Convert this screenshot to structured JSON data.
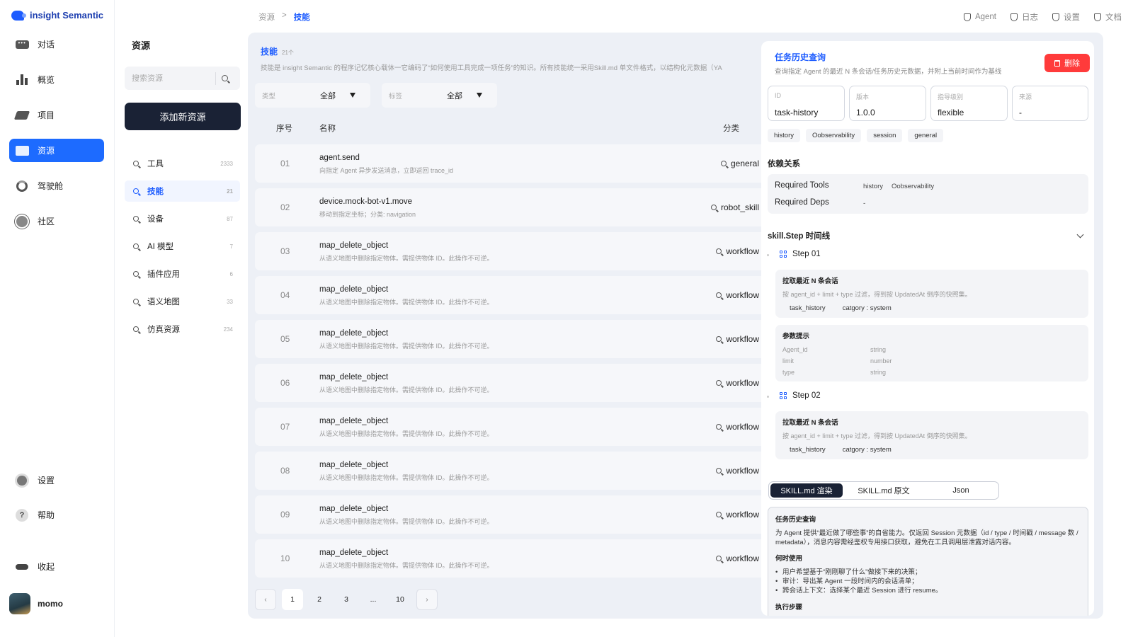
{
  "app": {
    "title": "insight Semantic"
  },
  "nav": {
    "items": [
      {
        "label": "对话",
        "icon": "chat-icon"
      },
      {
        "label": "概览",
        "icon": "chart-icon"
      },
      {
        "label": "项目",
        "icon": "layers-icon"
      },
      {
        "label": "资源",
        "icon": "folder-icon",
        "active": true
      },
      {
        "label": "驾驶舱",
        "icon": "cockpit-icon"
      },
      {
        "label": "社区",
        "icon": "planet-icon"
      }
    ],
    "bottom": [
      {
        "label": "设置",
        "icon": "gear-icon"
      },
      {
        "label": "帮助",
        "icon": "help-icon"
      }
    ],
    "collapse_label": "收起",
    "user_name": "momo"
  },
  "resources": {
    "title": "资源",
    "search_placeholder": "搜索资源",
    "add_button": "添加新资源",
    "categories": [
      {
        "label": "工具",
        "count": "2333"
      },
      {
        "label": "技能",
        "count": "21",
        "active": true
      },
      {
        "label": "设备",
        "count": "87"
      },
      {
        "label": "AI 模型",
        "count": "7"
      },
      {
        "label": "插件应用",
        "count": "6"
      },
      {
        "label": "语义地图",
        "count": "33"
      },
      {
        "label": "仿真资源",
        "count": "234"
      }
    ]
  },
  "breadcrumb": {
    "root": "资源",
    "sep": ">",
    "current": "技能"
  },
  "topnav": [
    "Agent",
    "日志",
    "设置",
    "文档"
  ],
  "list": {
    "title": "技能",
    "count": "21个",
    "desc": "技能是 insight Semantic 的程序记忆核心载体一它编码了“如何使用工具完成一项任务”的知识。所有技能统一采用Skill.md 单文件格式，以结构化元数据（YA",
    "filters": [
      {
        "label": "类型",
        "value": "全部"
      },
      {
        "label": "标签",
        "value": "全部"
      }
    ],
    "columns": {
      "no": "序号",
      "name": "名称",
      "category": "分类"
    },
    "rows": [
      {
        "no": "01",
        "name": "agent.send",
        "desc": "向指定 Agent 异步发送消息，立即返回 trace_id",
        "category": "general"
      },
      {
        "no": "02",
        "name": "device.mock-bot-v1.move",
        "desc": "移动到指定坐标；分类: navigation",
        "category": "robot_skill"
      },
      {
        "no": "03",
        "name": "map_delete_object",
        "desc": "从语义地图中删除指定物体。需提供物体 ID。此操作不可逆。",
        "category": "workflow"
      },
      {
        "no": "04",
        "name": "map_delete_object",
        "desc": "从语义地图中删除指定物体。需提供物体 ID。此操作不可逆。",
        "category": "workflow"
      },
      {
        "no": "05",
        "name": "map_delete_object",
        "desc": "从语义地图中删除指定物体。需提供物体 ID。此操作不可逆。",
        "category": "workflow"
      },
      {
        "no": "06",
        "name": "map_delete_object",
        "desc": "从语义地图中删除指定物体。需提供物体 ID。此操作不可逆。",
        "category": "workflow"
      },
      {
        "no": "07",
        "name": "map_delete_object",
        "desc": "从语义地图中删除指定物体。需提供物体 ID。此操作不可逆。",
        "category": "workflow"
      },
      {
        "no": "08",
        "name": "map_delete_object",
        "desc": "从语义地图中删除指定物体。需提供物体 ID。此操作不可逆。",
        "category": "workflow"
      },
      {
        "no": "09",
        "name": "map_delete_object",
        "desc": "从语义地图中删除指定物体。需提供物体 ID。此操作不可逆。",
        "category": "workflow"
      },
      {
        "no": "10",
        "name": "map_delete_object",
        "desc": "从语义地图中删除指定物体。需提供物体 ID。此操作不可逆。",
        "category": "workflow"
      }
    ],
    "pager": {
      "pages": [
        "1",
        "2",
        "3",
        "...",
        "10"
      ],
      "current": "1"
    }
  },
  "detail": {
    "title": "任务历史查询",
    "subtitle": "查询指定 Agent 的最近 N 条会话/任务历史元数据，并附上当前时间作为基线",
    "delete_label": "删除",
    "fields": [
      {
        "label": "ID",
        "value": "task-history"
      },
      {
        "label": "版本",
        "value": "1.0.0"
      },
      {
        "label": "指导级别",
        "value": "flexible"
      },
      {
        "label": "来源",
        "value": "-"
      }
    ],
    "tags": [
      "history",
      "Oobservability",
      "session",
      "general"
    ],
    "deps_title": "依赖关系",
    "required_tools_label": "Required Tools",
    "required_tools": [
      "history",
      "Oobservability"
    ],
    "required_deps_label": "Required Deps",
    "required_deps": "-",
    "timeline_title": "skill.Step 时间线",
    "steps": [
      {
        "label": "Step 01",
        "card_title": "拉取最近 N 条会话",
        "card_desc": "按 agent_id + limit + type 过滤，得到按 UpdatedAt 倒序的快照集。",
        "chips": [
          "task_history",
          "catgory : system"
        ],
        "param_title": "参数提示",
        "params": [
          {
            "name": "Agent_id",
            "type": "string"
          },
          {
            "name": "limit",
            "type": "number"
          },
          {
            "name": "type",
            "type": "string"
          }
        ]
      },
      {
        "label": "Step 02",
        "card_title": "拉取最近 N 条会话",
        "card_desc": "按 agent_id + limit + type 过滤，得到按 UpdatedAt 倒序的快照集。",
        "chips": [
          "task_history",
          "catgory : system"
        ]
      }
    ],
    "tabs": [
      "SKILL.md 渲染",
      "SKILL.md 原文",
      "Json"
    ],
    "render": {
      "h1": "任务历史查询",
      "p1": "为 Agent 提供“最近做了哪些事”的自省能力。仅返回 Session 元数据（id / type / 时间戳 / message 数 / metadata），消息内容需经鉴权专用接口获取，避免在工具调用层泄露对话内容。",
      "h2": "何时使用",
      "bullets": [
        "用户希望基于“刚刚聊了什么”做接下来的决策；",
        "审计：导出某 Agent 一段时间内的会话清单；",
        "跨会话上下文：选择某个最近 Session 进行 resume。"
      ],
      "h3": "执行步骤"
    }
  },
  "colors": {
    "accent": "#1d6bff",
    "dark": "#1a2235",
    "danger": "#ff3b3b",
    "bg": "#edf0f6"
  }
}
